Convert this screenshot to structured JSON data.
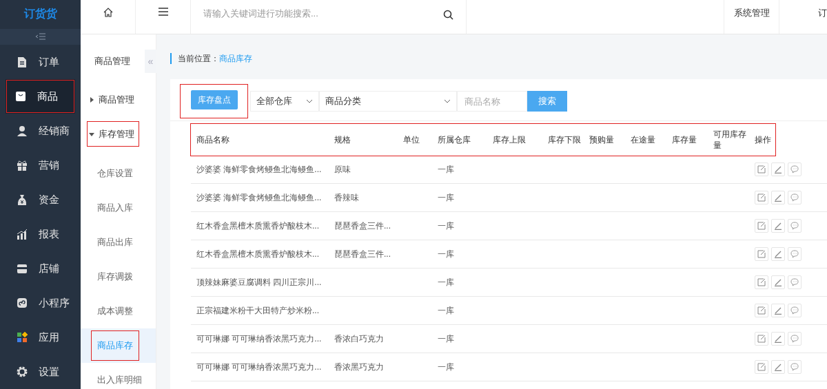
{
  "logo": "订货货",
  "main_nav": [
    {
      "label": "订单",
      "selected": false,
      "highlighted": false
    },
    {
      "label": "商品",
      "selected": true,
      "highlighted": true
    },
    {
      "label": "经销商",
      "selected": false,
      "highlighted": false
    },
    {
      "label": "营销",
      "selected": false,
      "highlighted": false
    },
    {
      "label": "资金",
      "selected": false,
      "highlighted": false
    },
    {
      "label": "报表",
      "selected": false,
      "highlighted": false
    },
    {
      "label": "店铺",
      "selected": false,
      "highlighted": false
    },
    {
      "label": "小程序",
      "selected": false,
      "highlighted": false
    },
    {
      "label": "应用",
      "selected": false,
      "highlighted": false
    },
    {
      "label": "设置",
      "selected": false,
      "highlighted": false
    }
  ],
  "sub_nav": {
    "title": "商品管理",
    "collapse": "«",
    "groups": [
      {
        "label": "商品管理",
        "expanded": false,
        "highlighted": false
      },
      {
        "label": "库存管理",
        "expanded": true,
        "highlighted": true,
        "children": [
          {
            "label": "仓库设置",
            "selected": false,
            "highlighted": false
          },
          {
            "label": "商品入库",
            "selected": false,
            "highlighted": false
          },
          {
            "label": "商品出库",
            "selected": false,
            "highlighted": false
          },
          {
            "label": "库存调拨",
            "selected": false,
            "highlighted": false
          },
          {
            "label": "成本调整",
            "selected": false,
            "highlighted": false
          },
          {
            "label": "商品库存",
            "selected": true,
            "highlighted": true
          },
          {
            "label": "出入库明细",
            "selected": false,
            "highlighted": false
          }
        ]
      }
    ]
  },
  "top_bar": {
    "search": {
      "placeholder": "请输入关键词进行功能搜索..."
    },
    "links": [
      "系统管理",
      "订"
    ]
  },
  "breadcrumb": {
    "label": "当前位置：",
    "current": "商品库存"
  },
  "toolbar": {
    "stocktake_button": {
      "label": "库存盘点",
      "highlighted": true
    },
    "warehouse_select": "全部仓库",
    "category_select": "商品分类",
    "name_field": {
      "placeholder": "商品名称"
    },
    "search_button": "搜索"
  },
  "table": {
    "header_highlighted": true,
    "columns": [
      "商品名称",
      "规格",
      "单位",
      "所属仓库",
      "库存上限",
      "库存下限",
      "预购量",
      "在途量",
      "库存量",
      "可用库存量",
      "操作"
    ],
    "rows": [
      {
        "name": "沙婆婆 海鲜零食烤鳗鱼北海鳗鱼...",
        "spec": "原味",
        "warehouse": "一库"
      },
      {
        "name": "沙婆婆 海鲜零食烤鳗鱼北海鳗鱼...",
        "spec": "香辣味",
        "warehouse": "一库"
      },
      {
        "name": "红木香盒黑檀木质熏香炉酸枝木...",
        "spec": "琵琶香盒三件...",
        "warehouse": "一库"
      },
      {
        "name": "红木香盒黑檀木质熏香炉酸枝木...",
        "spec": "琵琶香盒三件...",
        "warehouse": "一库"
      },
      {
        "name": "顶辣妹麻婆豆腐调料 四川正宗川...",
        "warehouse": "一库"
      },
      {
        "name": "正宗福建米粉干大田特产炒米粉...",
        "warehouse": "一库"
      },
      {
        "name": "可可琳娜 可可琳纳香浓黑巧克力...",
        "spec": "香浓白巧克力",
        "warehouse": "一库"
      },
      {
        "name": "可可琳娜 可可琳纳香浓黑巧克力...",
        "spec": "香浓黑巧克力",
        "warehouse": "一库"
      }
    ]
  }
}
